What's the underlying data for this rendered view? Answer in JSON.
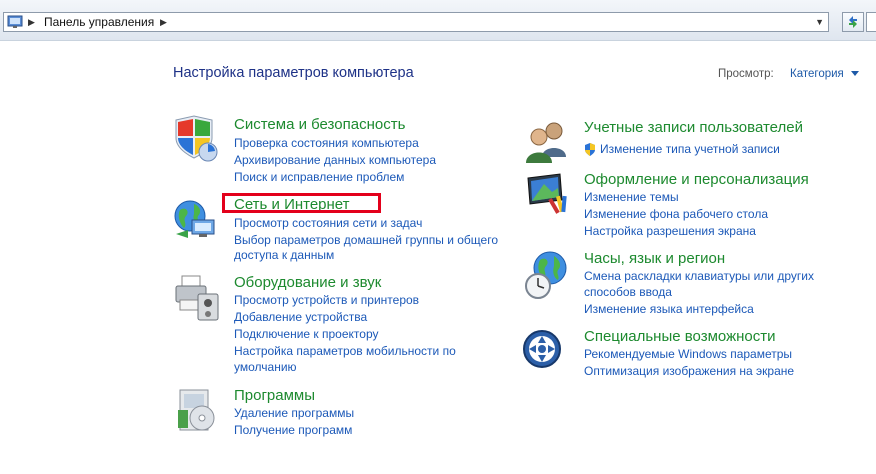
{
  "address_bar": {
    "breadcrumb": "Панель управления"
  },
  "header": {
    "title": "Настройка параметров компьютера",
    "view_label": "Просмотр:",
    "view_value": "Категория"
  },
  "categories_left": [
    {
      "title": "Система и безопасность",
      "icon": "system-security-shield-icon",
      "links": [
        "Проверка состояния компьютера",
        "Архивирование данных компьютера",
        "Поиск и исправление проблем"
      ]
    },
    {
      "title": "Сеть и Интернет",
      "icon": "network-globe-icon",
      "links": [
        "Просмотр состояния сети и задач",
        "Выбор параметров домашней группы и общего",
        "доступа к данным"
      ]
    },
    {
      "title": "Оборудование и звук",
      "icon": "printer-speaker-icon",
      "links": [
        "Просмотр устройств и принтеров",
        "Добавление устройства",
        "Подключение к проектору",
        "Настройка параметров мобильности по",
        "умолчанию"
      ]
    },
    {
      "title": "Программы",
      "icon": "programs-disc-icon",
      "links": [
        "Удаление программы",
        "Получение программ"
      ]
    }
  ],
  "categories_right": [
    {
      "title": "Учетные записи пользователей",
      "icon": "user-accounts-icon",
      "links": [
        "Изменение типа учетной записи"
      ]
    },
    {
      "title": "Оформление и персонализация",
      "icon": "appearance-monitor-icon",
      "links": [
        "Изменение темы",
        "Изменение фона рабочего стола",
        "Настройка разрешения экрана"
      ]
    },
    {
      "title": "Часы, язык и регион",
      "icon": "clock-globe-icon",
      "links": [
        "Смена раскладки клавиатуры или других",
        "способов ввода",
        "Изменение языка интерфейса"
      ]
    },
    {
      "title": "Специальные возможности",
      "icon": "ease-of-access-icon",
      "links": [
        "Рекомендуемые Windows параметры",
        "Оптимизация изображения на экране"
      ]
    }
  ],
  "colors": {
    "category_title": "#1d8a2f",
    "link": "#1c59b8",
    "heading": "#1e3287",
    "highlight": "#e3001b"
  }
}
